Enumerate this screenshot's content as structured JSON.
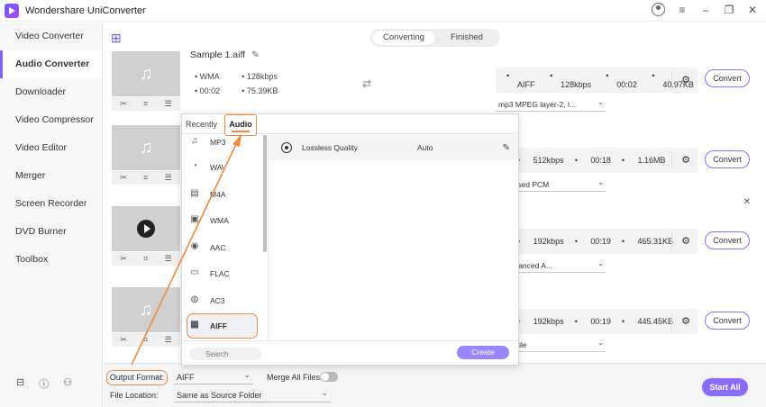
{
  "app": {
    "title": "Wondershare UniConverter"
  },
  "window_controls": [
    "user-icon",
    "menu-icon",
    "minimize-icon",
    "restore-icon",
    "close-icon"
  ],
  "sidebar": {
    "items": [
      {
        "label": "Video Converter"
      },
      {
        "label": "Audio Converter",
        "active": true
      },
      {
        "label": "Downloader"
      },
      {
        "label": "Video Compressor"
      },
      {
        "label": "Video Editor"
      },
      {
        "label": "Merger"
      },
      {
        "label": "Screen Recorder"
      },
      {
        "label": "DVD Burner"
      },
      {
        "label": "Toolbox"
      }
    ],
    "bottom_icons": [
      "book-icon",
      "help-icon",
      "people-icon"
    ]
  },
  "tabs": {
    "converting": "Converting",
    "finished": "Finished"
  },
  "files": [
    {
      "name": "Sample 1.aiff",
      "src_format": "WMA",
      "src_bitrate": "128kbps",
      "src_duration": "00:02",
      "src_size": "75.39KB",
      "target_format": "AIFF",
      "target_bitrate": "128kbps",
      "target_duration": "00:02",
      "target_size": "40.97KB",
      "encoder": "mp3 MPEG layer-2, l...",
      "convert": "Convert"
    },
    {
      "target_bitrate": "512kbps",
      "target_duration": "00:18",
      "target_size": "1.16MB",
      "encoder": "npressed PCM",
      "convert": "Convert"
    },
    {
      "target_bitrate": "192kbps",
      "target_duration": "00:19",
      "target_size": "465.31KB",
      "encoder": "n-Advanced A...",
      "convert": "Convert"
    },
    {
      "target_bitrate": "192kbps",
      "target_duration": "00:19",
      "target_size": "445.45KB",
      "encoder": "Test File",
      "convert": "Convert"
    }
  ],
  "popup": {
    "tab_recently": "Recently",
    "tab_audio": "Audio",
    "formats": [
      {
        "label": "MP3",
        "icon": "music-note-icon"
      },
      {
        "label": "WAV",
        "icon": "wav-icon"
      },
      {
        "label": "M4A",
        "icon": "m4a-icon"
      },
      {
        "label": "WMA",
        "icon": "wma-icon"
      },
      {
        "label": "AAC",
        "icon": "aac-icon"
      },
      {
        "label": "FLAC",
        "icon": "flac-icon"
      },
      {
        "label": "AC3",
        "icon": "ac3-icon"
      },
      {
        "label": "AIFF",
        "icon": "aiff-icon",
        "selected": true
      }
    ],
    "quality_label": "Lossless Quality",
    "quality_value": "Auto",
    "search_placeholder": "Search",
    "create": "Create"
  },
  "bottom": {
    "output_format_label": "Output Format:",
    "output_format_value": "AIFF",
    "merge_label": "Merge All Files:",
    "merge_enabled": false,
    "file_location_label": "File Location:",
    "file_location_value": "Same as Source Folder",
    "start_all": "Start All"
  },
  "colors": {
    "accent": "#8a6dff",
    "highlight": "#f08a3c"
  }
}
